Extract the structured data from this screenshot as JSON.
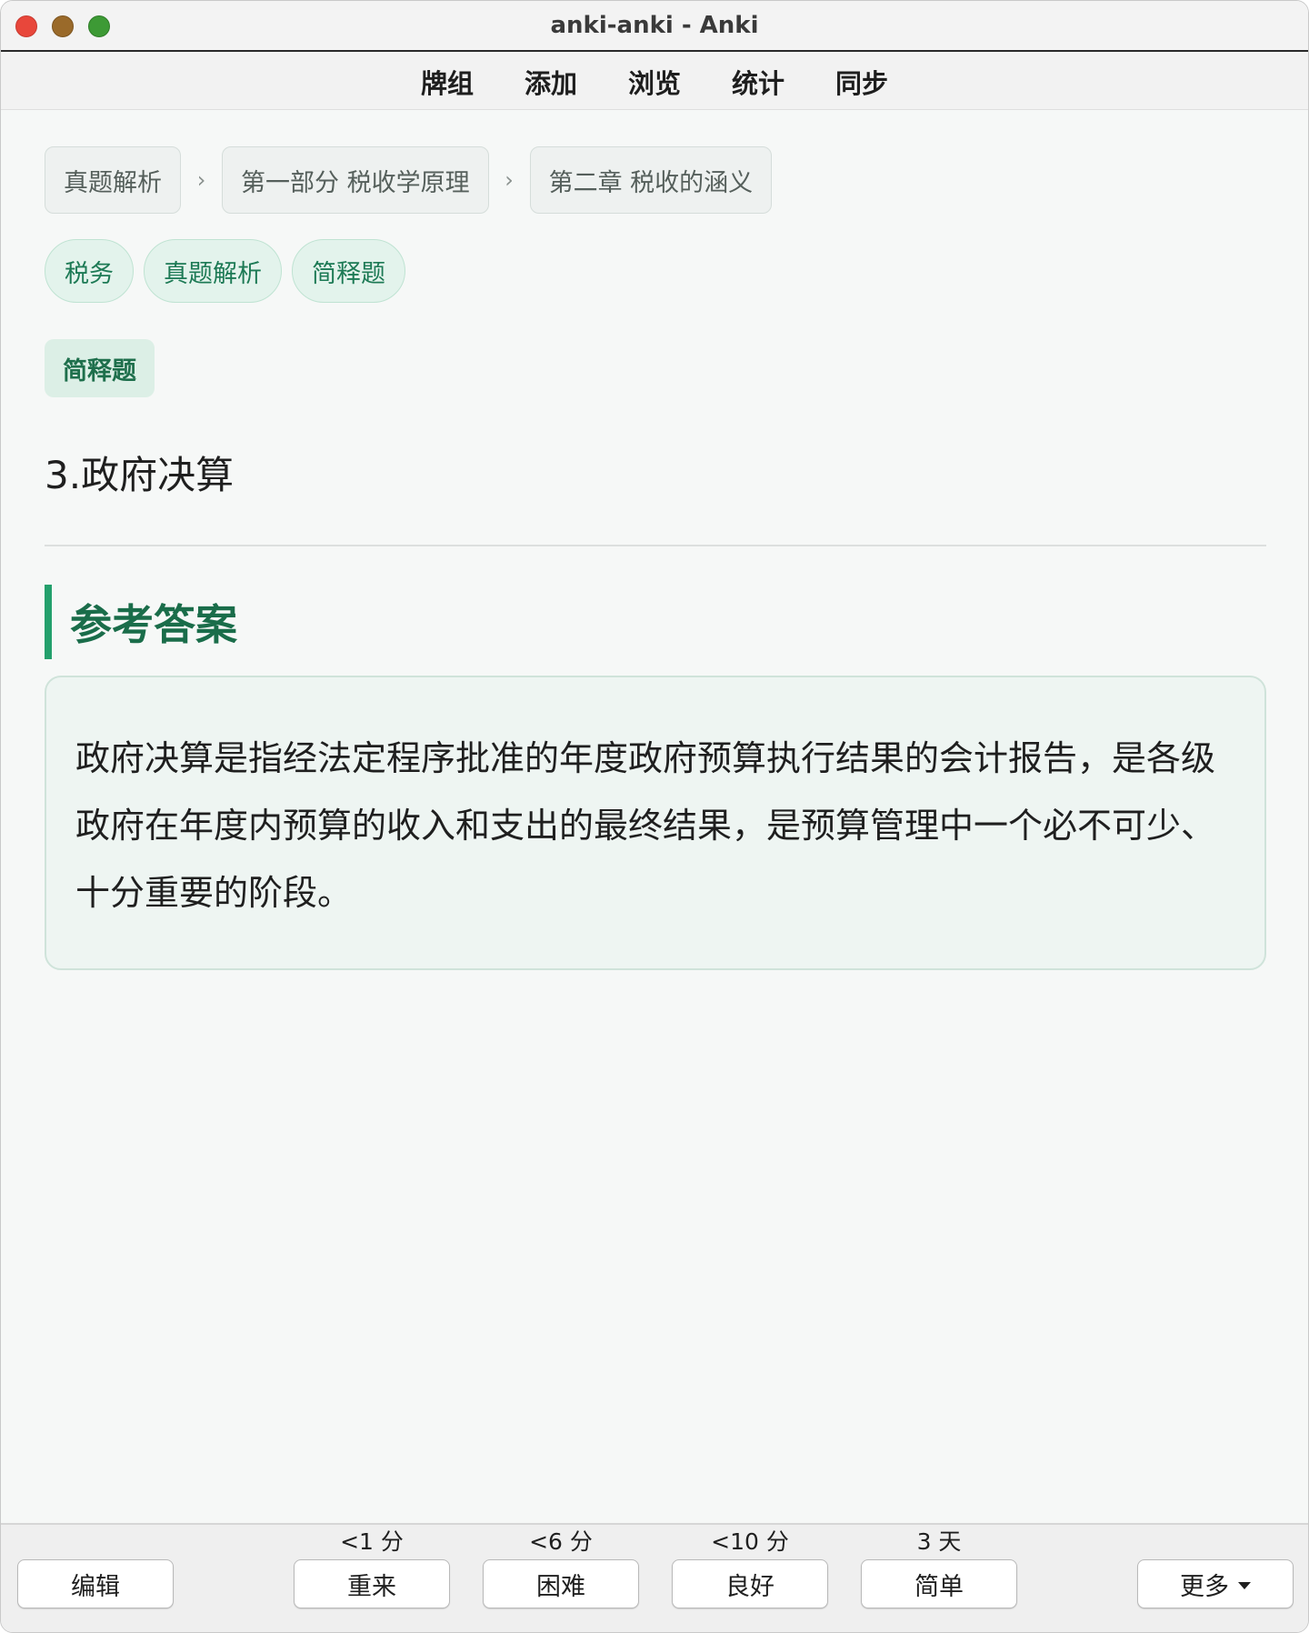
{
  "window": {
    "title": "anki-anki - Anki"
  },
  "toolbar": {
    "items": [
      "牌组",
      "添加",
      "浏览",
      "统计",
      "同步"
    ]
  },
  "breadcrumb": [
    "真题解析",
    "第一部分 税收学原理",
    "第二章 税收的涵义"
  ],
  "breadcrumb_separator": "›",
  "tags": [
    "税务",
    "真题解析",
    "简释题"
  ],
  "card": {
    "type_label": "简释题",
    "question": "3.政府决算",
    "answer_heading": "参考答案",
    "answer_text": "政府决算是指经法定程序批准的年度政府预算执行结果的会计报告，是各级政府在年度内预算的收入和支出的最终结果，是预算管理中一个必不可少、十分重要的阶段。"
  },
  "bottom": {
    "edit_label": "编辑",
    "more_label": "更多",
    "answers": [
      {
        "interval": "<1 分",
        "label": "重来"
      },
      {
        "interval": "<6 分",
        "label": "困难"
      },
      {
        "interval": "<10 分",
        "label": "良好"
      },
      {
        "interval": "3 天",
        "label": "简单"
      }
    ]
  },
  "colors": {
    "accent": "#23a06c",
    "accent_text": "#1a6d4a",
    "close": "#e8473b",
    "minimize": "#9a6a2a",
    "maximize": "#3d9a35"
  }
}
